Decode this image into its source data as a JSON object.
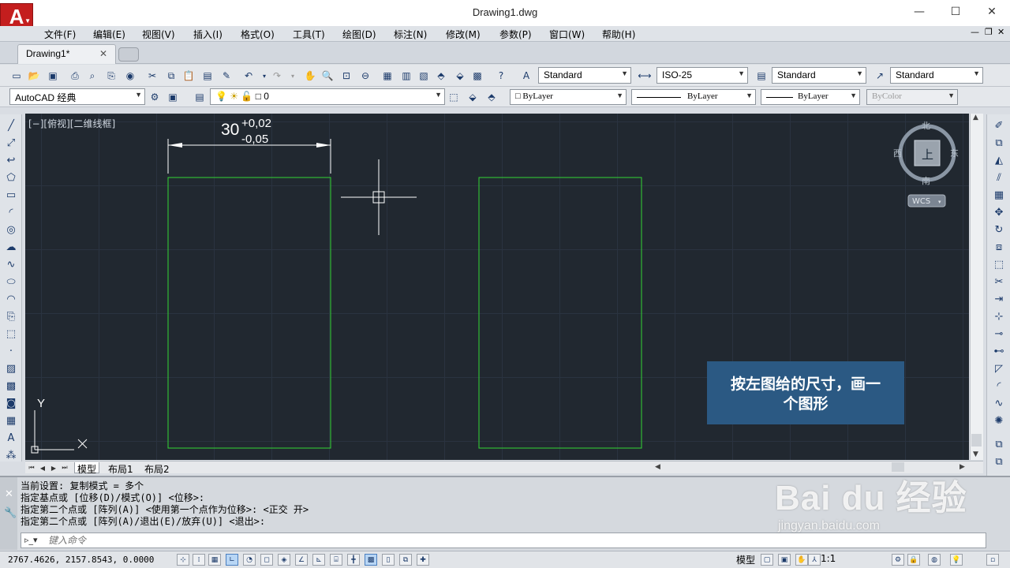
{
  "window": {
    "title": "Drawing1.dwg",
    "logo_letter": "A",
    "minimize": "—",
    "maximize": "☐",
    "close": "✕"
  },
  "menu": [
    "文件(F)",
    "编辑(E)",
    "视图(V)",
    "插入(I)",
    "格式(O)",
    "工具(T)",
    "绘图(D)",
    "标注(N)",
    "修改(M)",
    "参数(P)",
    "窗口(W)",
    "帮助(H)"
  ],
  "tabs": {
    "document": "Drawing1*",
    "close": "✕"
  },
  "styles_toolbar": {
    "text_style": "Standard",
    "dim_style": "ISO-25",
    "table_style": "Standard",
    "multileader_style": "Standard"
  },
  "layers_toolbar": {
    "workspace": "AutoCAD 经典",
    "layer": "0",
    "color": "ByLayer",
    "linetype": "ByLayer",
    "lineweight": "ByLayer",
    "plotstyle": "ByColor"
  },
  "viewport": {
    "label": "[−][俯视][二维线框]",
    "dimension_main": "30",
    "tol_upper": "+0,02",
    "tol_lower": "-0,05",
    "ucs_y": "Y"
  },
  "viewcube": {
    "north": "北",
    "south": "南",
    "east": "东",
    "west": "西",
    "face": "上",
    "wcs": "WCS"
  },
  "layout_tabs": [
    "模型",
    "布局1",
    "布局2"
  ],
  "command_history": [
    "当前设置:  复制模式 = 多个",
    "指定基点或 [位移(D)/模式(O)] <位移>:",
    "指定第二个点或 [阵列(A)] <使用第一个点作为位移>: <正交 开>",
    "指定第二个点或 [阵列(A)/退出(E)/放弃(U)] <退出>:"
  ],
  "command_input": {
    "placeholder": "键入命令"
  },
  "status": {
    "coordinates": "2767.4626, 2157.8543, 0.0000",
    "model": "模型",
    "scale": "1:1"
  },
  "annotation": {
    "line1": "按左图给的尺寸，画一",
    "line2": "个图形"
  },
  "watermark": {
    "main": "Bai du 经验",
    "sub": "jingyan.baidu.com"
  },
  "colors": {
    "canvas_bg": "#212830",
    "rect_stroke": "#33d633",
    "note_bg": "#2b5983",
    "logo_red": "#c41e1e"
  }
}
